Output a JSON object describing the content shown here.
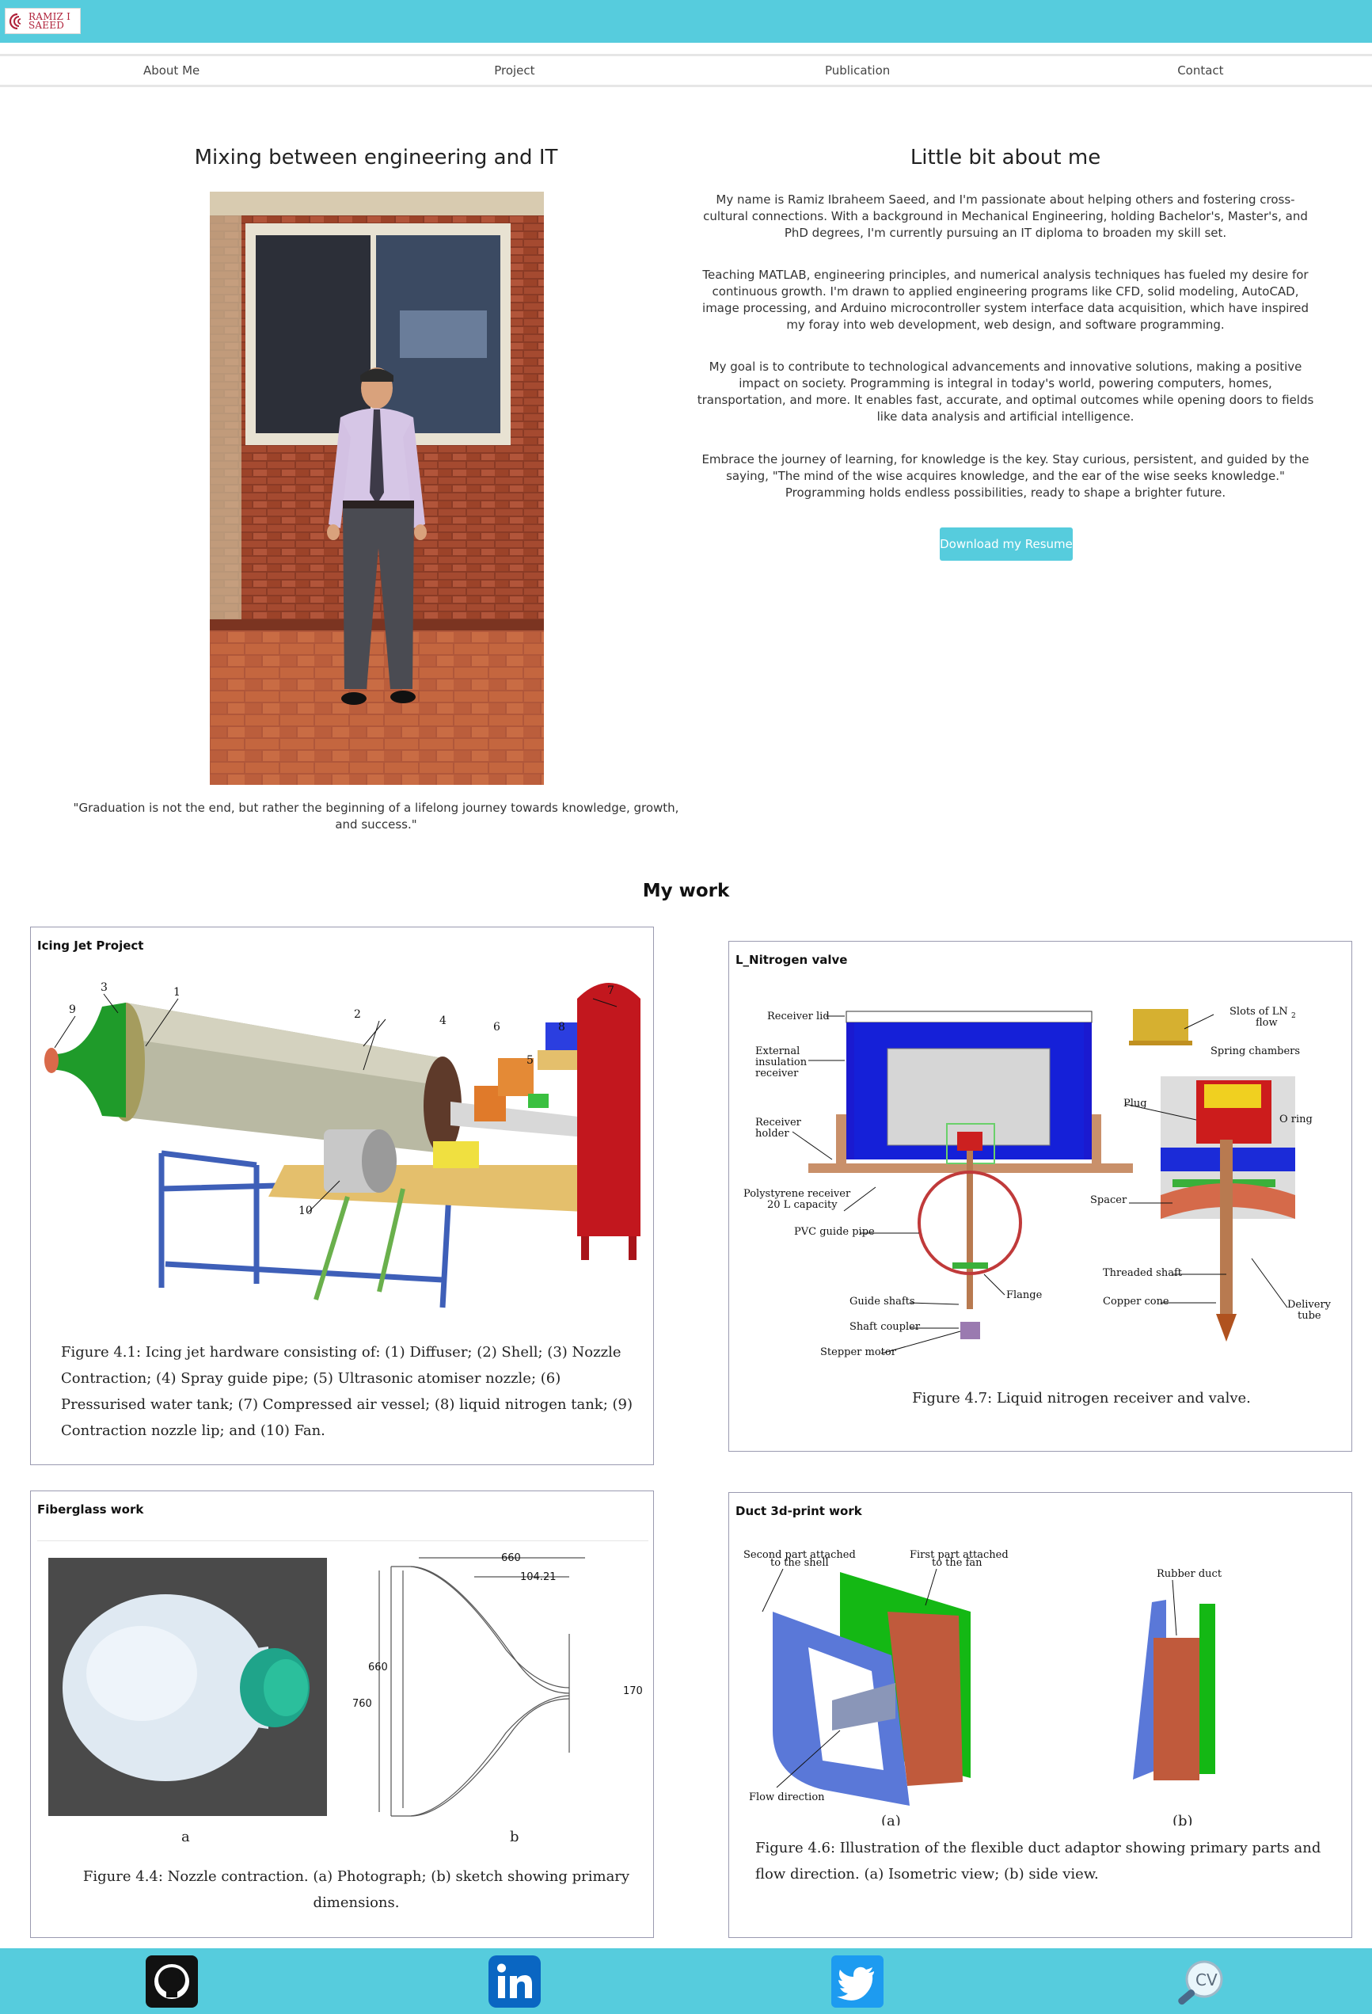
{
  "header": {
    "logo_line1": "RAMIZ I",
    "logo_line2": "SAEED"
  },
  "nav": {
    "items": [
      "About Me",
      "Project",
      "Publication",
      "Contact"
    ]
  },
  "about": {
    "left_title": "Mixing between engineering and IT",
    "right_title": "Little bit about me",
    "quote": "\"Graduation is not the end, but rather the beginning of a lifelong journey towards knowledge, growth, and success.\"",
    "paragraphs": [
      "My name is Ramiz Ibraheem Saeed, and I'm passionate about helping others and fostering cross-cultural connections. With a background in Mechanical Engineering, holding Bachelor's, Master's, and PhD degrees, I'm currently pursuing an IT diploma to broaden my skill set.",
      "Teaching MATLAB, engineering principles, and numerical analysis techniques has fueled my desire for continuous growth. I'm drawn to applied engineering programs like CFD, solid modeling, AutoCAD, image processing, and Arduino microcontroller system interface data acquisition, which have inspired my foray into web development, web design, and software programming.",
      "My goal is to contribute to technological advancements and innovative solutions, making a positive impact on society. Programming is integral in today's world, powering computers, homes, transportation, and more. It enables fast, accurate, and optimal outcomes while opening doors to fields like data analysis and artificial intelligence.",
      "Embrace the journey of learning, for knowledge is the key. Stay curious, persistent, and guided by the saying, \"The mind of the wise acquires knowledge, and the ear of the wise seeks knowledge.\" Programming holds endless possibilities, ready to shape a brighter future."
    ],
    "resume_button": "Download my Resume"
  },
  "work": {
    "title": "My work",
    "cards": [
      {
        "title": "Icing Jet Project",
        "caption": "Figure 4.1: Icing jet hardware consisting of: (1) Diffuser; (2) Shell; (3) Nozzle Contraction; (4) Spray guide pipe; (5) Ultrasonic atomiser nozzle; (6) Pressurised water tank; (7) Compressed air vessel; (8) liquid nitrogen tank; (9) Contraction nozzle lip; and (10) Fan.",
        "labels": [
          "9",
          "3",
          "1",
          "2",
          "4",
          "6",
          "8",
          "7",
          "5",
          "10"
        ]
      },
      {
        "title": "L_Nitrogen valve",
        "caption": "Figure 4.7: Liquid nitrogen receiver and valve.",
        "labels": {
          "receiver_lid": "Receiver lid",
          "ext1": "External",
          "ext2": "insulation",
          "ext3": "receiver",
          "holder1": "Receiver",
          "holder2": "holder",
          "poly1": "Polystyrene receiver",
          "poly2": "20 L capacity",
          "pvc": "PVC guide pipe",
          "guide": "Guide shafts",
          "coupler": "Shaft coupler",
          "stepper": "Stepper motor",
          "flange": "Flange",
          "slots1": "Slots of LN",
          "slots_sub": "2",
          "slots2": "flow",
          "spring": "Spring chambers",
          "plug": "Plug",
          "oring": "O ring",
          "spacer": "Spacer",
          "threaded": "Threaded shaft",
          "copper": "Copper cone",
          "delivery1": "Delivery",
          "delivery2": "tube"
        }
      },
      {
        "title": "Fiberglass work",
        "caption": "Figure 4.4: Nozzle contraction. (a) Photograph; (b) sketch showing primary dimensions.",
        "labels": {
          "a": "a",
          "b": "b",
          "d660top": "660",
          "d104": "104.21",
          "d660": "660",
          "d760": "760",
          "d170": "170"
        }
      },
      {
        "title": "Duct 3d-print work",
        "caption": "Figure 4.6: Illustration of the flexible duct adaptor showing primary parts and flow direction. (a) Isometric view; (b) side view.",
        "labels": {
          "second1": "Second part attached",
          "second2": "to the shell",
          "first1": "First part attached",
          "first2": "to the fan",
          "rubber": "Rubber duct",
          "flow": "Flow direction",
          "a": "(a)",
          "b": "(b)"
        }
      }
    ]
  },
  "footer": {
    "icons": [
      "github-icon",
      "linkedin-icon",
      "twitter-icon",
      "cv-icon"
    ],
    "cv_text": "CV"
  },
  "colors": {
    "accent": "#56ccdd",
    "logo_red": "#b0223a",
    "card_border": "#9a9ab0"
  }
}
